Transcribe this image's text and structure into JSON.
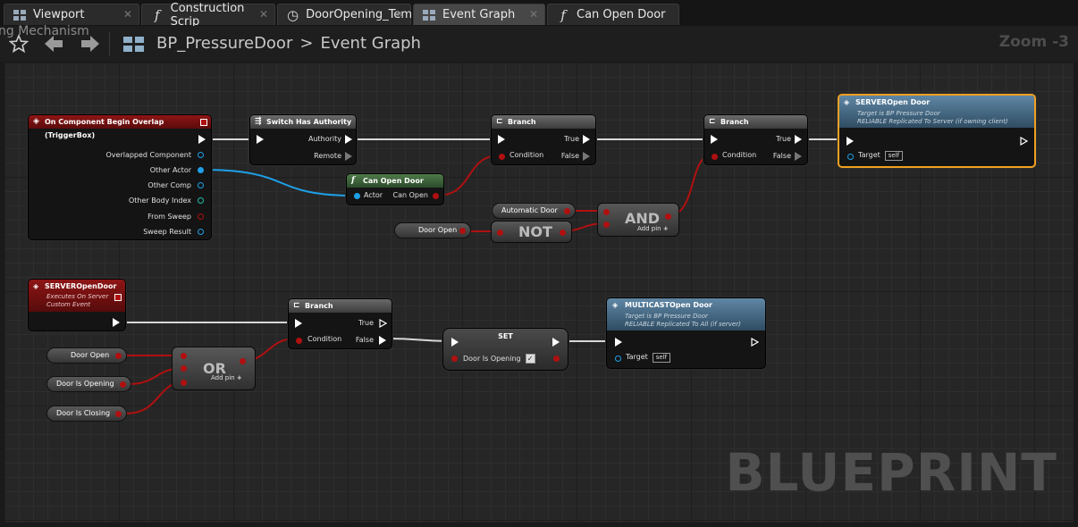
{
  "tabs": [
    {
      "label": "Viewport",
      "icon": "viewport-icon"
    },
    {
      "label": "Construction Scrip",
      "icon": "function-icon"
    },
    {
      "label": "DoorOpening_Tem",
      "icon": "timeline-icon"
    },
    {
      "label": "Event Graph",
      "icon": "graph-icon"
    },
    {
      "label": "Can Open Door",
      "icon": "function-icon"
    }
  ],
  "toolbar": {
    "faded_label": "ng Mechanism",
    "breadcrumb_root": "BP_PressureDoor",
    "breadcrumb_separator": ">",
    "breadcrumb_current": "Event Graph",
    "zoom": "Zoom -3"
  },
  "watermark": "BLUEPRINT",
  "nodes": {
    "overlap": {
      "title": "On Component Begin Overlap (TriggerBox)",
      "pins": [
        "Overlapped Component",
        "Other Actor",
        "Other Comp",
        "Other Body Index",
        "From Sweep",
        "Sweep Result"
      ]
    },
    "authority": {
      "title": "Switch Has Authority",
      "pins": [
        "Authority",
        "Remote"
      ]
    },
    "branch1": {
      "title": "Branch",
      "condition": "Condition",
      "true": "True",
      "false": "False"
    },
    "branch2": {
      "title": "Branch",
      "condition": "Condition",
      "true": "True",
      "false": "False"
    },
    "canopen": {
      "title": "Can Open Door",
      "actor": "Actor",
      "out": "Can Open"
    },
    "server_call": {
      "title": "SERVEROpen Door",
      "sub1": "Target is BP Pressure Door",
      "sub2": "RELIABLE Replicated To Server (if owning client)",
      "target": "Target",
      "self": "self"
    },
    "automatic": {
      "label": "Automatic Door"
    },
    "door_open_var1": {
      "label": "Door Open"
    },
    "not": {
      "label": "NOT"
    },
    "and": {
      "label": "AND",
      "addpin": "Add pin"
    },
    "server_event": {
      "title": "SERVEROpenDoor",
      "sub1": "Executes On Server",
      "sub2": "Custom Event"
    },
    "door_open_var2": {
      "label": "Door Open"
    },
    "door_is_opening_var": {
      "label": "Door Is Opening"
    },
    "door_is_closing_var": {
      "label": "Door Is Closing"
    },
    "or": {
      "label": "OR",
      "addpin": "Add pin"
    },
    "branch3": {
      "title": "Branch",
      "condition": "Condition",
      "true": "True",
      "false": "False"
    },
    "set": {
      "title": "SET",
      "var": "Door Is Opening"
    },
    "multicast": {
      "title": "MULTICASTOpen Door",
      "sub1": "Target is BP Pressure Door",
      "sub2": "RELIABLE Replicated To All (if server)",
      "target": "Target",
      "self": "self"
    }
  },
  "colors": {
    "exec": "#ffffff",
    "bool": "#b01010",
    "object": "#1ea0e8",
    "event_header": "#8e1515",
    "call_header": "#5a7f9a"
  }
}
